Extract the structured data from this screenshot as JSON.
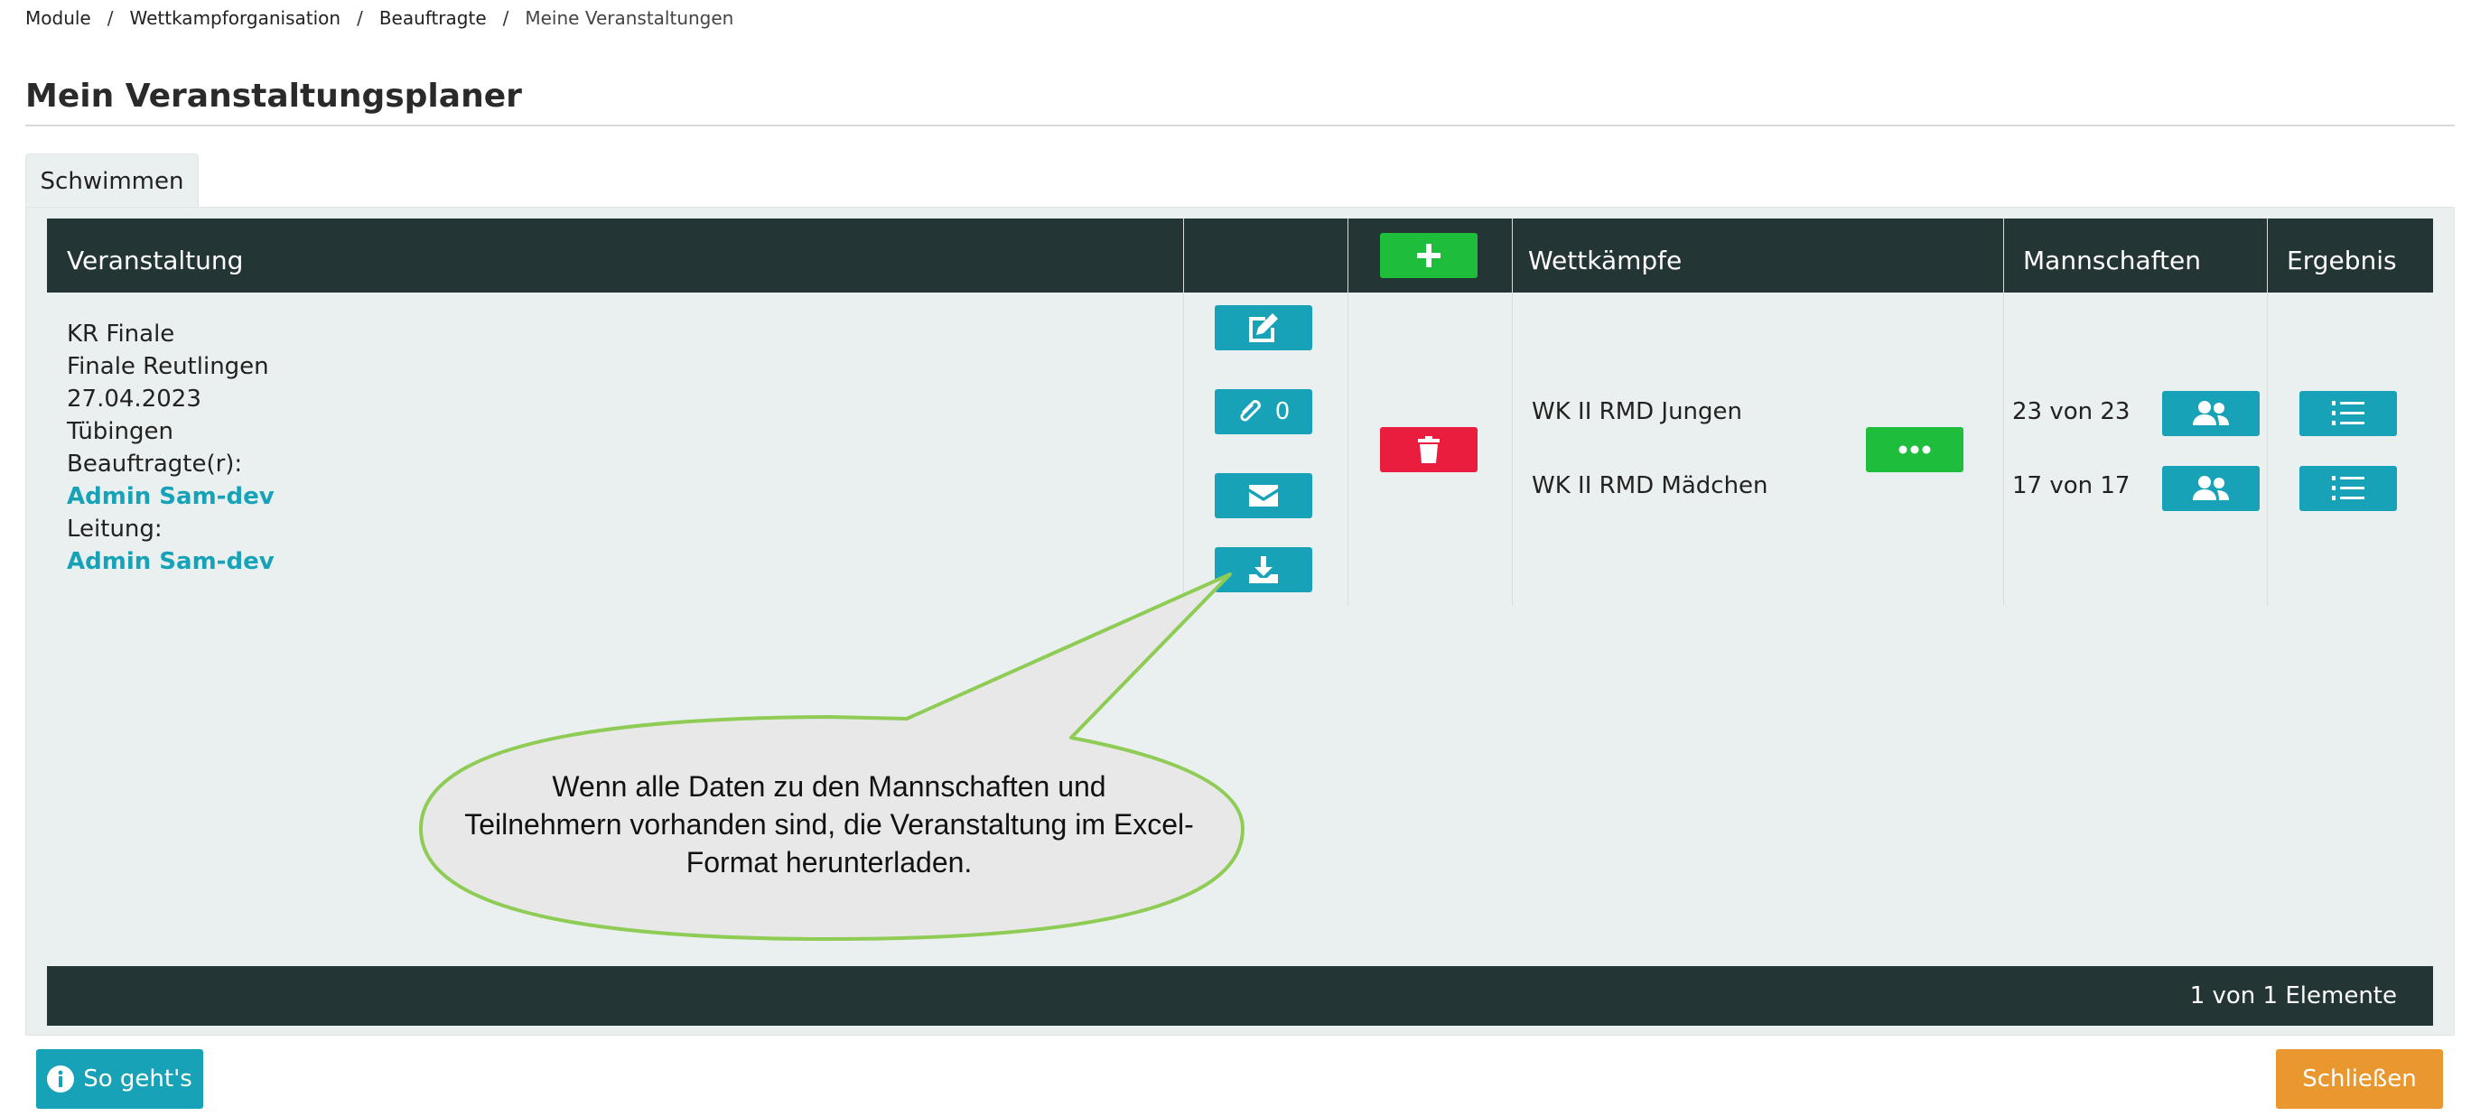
{
  "breadcrumb": [
    "Module",
    "Wettkampforganisation",
    "Beauftragte",
    "Meine Veranstaltungen"
  ],
  "page_title": "Mein Veranstaltungsplaner",
  "tabs": [
    {
      "label": "Schwimmen",
      "active": true
    }
  ],
  "table": {
    "headers": {
      "veranstaltung": "Veranstaltung",
      "wettkaempfe": "Wettkämpfe",
      "mannschaften": "Mannschaften",
      "ergebnis": "Ergebnis"
    },
    "row": {
      "name": "KR Finale",
      "subtitle": "Finale Reutlingen",
      "date": "27.04.2023",
      "place": "Tübingen",
      "beauftragte_label": "Beauftragte(r):",
      "beauftragte_name": "Admin Sam-dev",
      "leitung_label": "Leitung:",
      "leitung_name": "Admin Sam-dev",
      "attachment_count": "0",
      "wettkaempfe": [
        {
          "name": "WK II RMD Jungen",
          "mannschaften": "23 von 23"
        },
        {
          "name": "WK II RMD Mädchen",
          "mannschaften": "17 von 17"
        }
      ]
    },
    "footer": "1 von 1 Elemente"
  },
  "callout": {
    "lines": [
      "Wenn alle Daten zu den Mannschaften und",
      "Teilnehmern vorhanden sind, die Veranstaltung im Excel-",
      "Format herunterladen."
    ]
  },
  "buttons": {
    "help": "So geht's",
    "close": "Schließen"
  },
  "colors": {
    "teal": "#17a2b8",
    "green": "#1ebe3c",
    "red": "#ea1d3f",
    "orange": "#e9982f",
    "header_dark": "#243535"
  }
}
